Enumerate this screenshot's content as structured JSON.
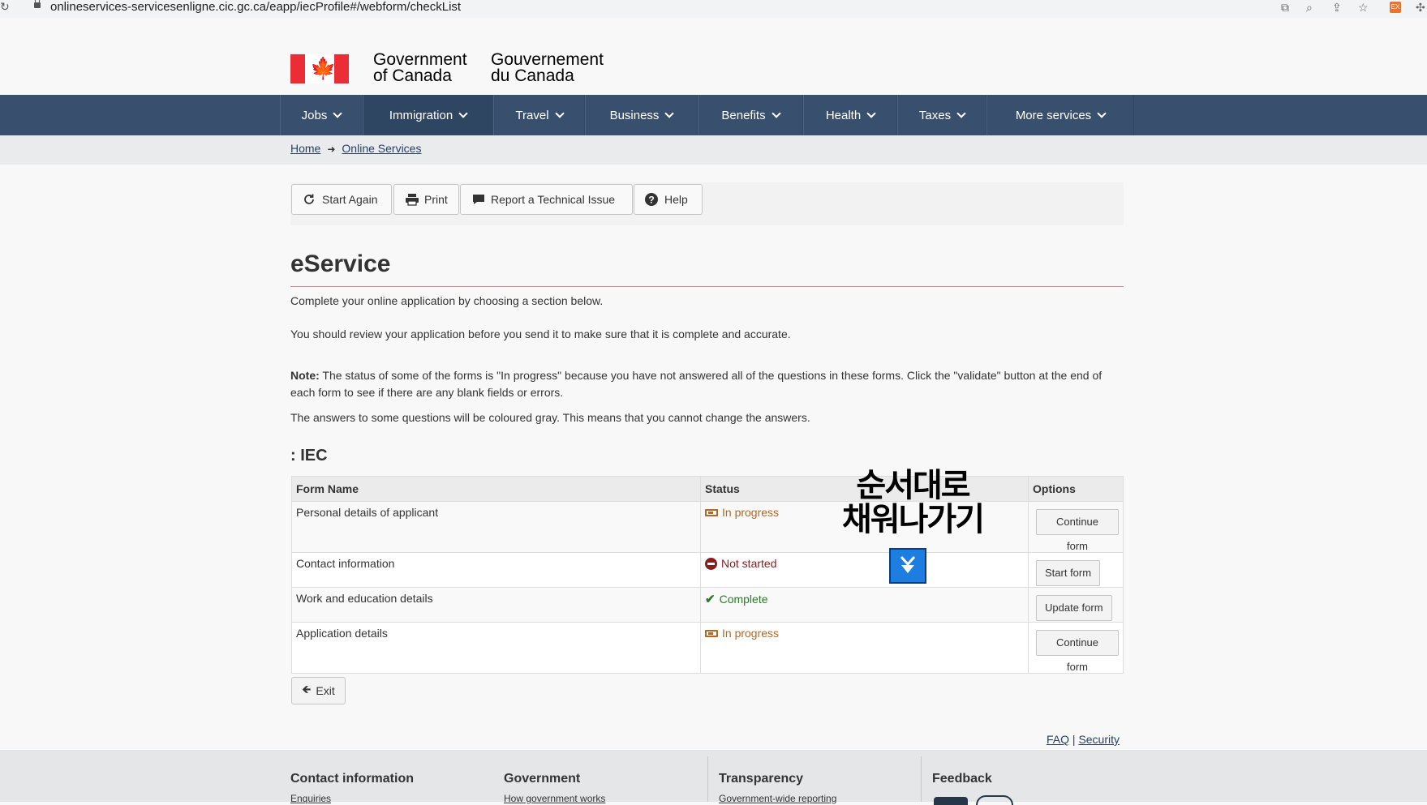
{
  "browser": {
    "url": "onlineservices-servicesenligne.cic.gc.ca/eapp/iecProfile#/webform/checkList"
  },
  "header": {
    "signature_en_line1": "Government",
    "signature_en_line2": "of Canada",
    "signature_fr_line1": "Gouvernement",
    "signature_fr_line2": "du Canada"
  },
  "nav": {
    "items": [
      {
        "label": "Jobs"
      },
      {
        "label": "Immigration"
      },
      {
        "label": "Travel"
      },
      {
        "label": "Business"
      },
      {
        "label": "Benefits"
      },
      {
        "label": "Health"
      },
      {
        "label": "Taxes"
      },
      {
        "label": "More services"
      }
    ],
    "active": "Immigration"
  },
  "breadcrumb": {
    "home": "Home",
    "online_services": "Online Services"
  },
  "toolbar": {
    "start_again": "Start Again",
    "print": "Print",
    "report": "Report a Technical Issue",
    "help": "Help"
  },
  "main": {
    "title": "eService",
    "intro1": "Complete your online application by choosing a section below.",
    "intro2": "You should review your application before you send it to make sure that it is complete and accurate.",
    "note_label": "Note:",
    "note_text": " The status of some of the forms is \"In progress\" because you have not answered all of the questions in these forms. Click the \"validate\" button at the end of each form to see if there are any blank fields or errors.",
    "gray_note": "The answers to some questions will be coloured gray. This means that you cannot change the answers.",
    "section_title": ": IEC"
  },
  "table": {
    "headers": {
      "form_name": "Form Name",
      "status": "Status",
      "options": "Options"
    },
    "rows": [
      {
        "form": "Personal details of applicant",
        "status": "In progress",
        "button": "Continue form"
      },
      {
        "form": "Contact information",
        "status": "Not started",
        "button": "Start form"
      },
      {
        "form": "Work and education details",
        "status": "Complete",
        "button": "Update form"
      },
      {
        "form": "Application details",
        "status": "In progress",
        "button": "Continue form"
      }
    ]
  },
  "annotation": {
    "line1": "순서대로",
    "line2": "채워나가기",
    "arrow": "⏬"
  },
  "exit_button": "Exit",
  "links": {
    "faq": "FAQ",
    "separator": " | ",
    "security": "Security"
  },
  "footer": {
    "contact": "Contact information",
    "contact_sub": "Enquiries",
    "government": "Government",
    "government_sub": "How government works",
    "transparency": "Transparency",
    "transparency_sub": "Government-wide reporting",
    "feedback": "Feedback"
  },
  "colors": {
    "nav_bg": "#38506d",
    "flag_red": "#eb2d37",
    "in_progress": "#b8661f",
    "not_started": "#8a1c1c",
    "complete": "#2d7a2d",
    "annotation_arrow": "#1d7de0"
  }
}
